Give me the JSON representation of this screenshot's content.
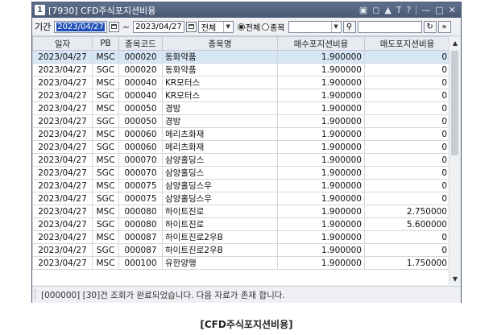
{
  "window": {
    "screen_no": "1",
    "title": "[7930] CFD주식포지션비용"
  },
  "toolbar": {
    "period_label": "기간",
    "date_from": "2023/04/27",
    "tilde": "~",
    "date_to": "2023/04/27",
    "market_select": "전체",
    "radio_all": "전체",
    "radio_item": "종목",
    "item_code": ""
  },
  "table": {
    "headers": [
      "일자",
      "PB",
      "종목코드",
      "종목명",
      "매수포지션비용",
      "매도포지션비용"
    ],
    "rows": [
      [
        "2023/04/27",
        "MSC",
        "000020",
        "동화약품",
        "1.900000",
        "0"
      ],
      [
        "2023/04/27",
        "SGC",
        "000020",
        "동화약품",
        "1.900000",
        "0"
      ],
      [
        "2023/04/27",
        "MSC",
        "000040",
        "KR모터스",
        "1.900000",
        "0"
      ],
      [
        "2023/04/27",
        "SGC",
        "000040",
        "KR모터스",
        "1.900000",
        "0"
      ],
      [
        "2023/04/27",
        "MSC",
        "000050",
        "경방",
        "1.900000",
        "0"
      ],
      [
        "2023/04/27",
        "SGC",
        "000050",
        "경방",
        "1.900000",
        "0"
      ],
      [
        "2023/04/27",
        "MSC",
        "000060",
        "메리츠화재",
        "1.900000",
        "0"
      ],
      [
        "2023/04/27",
        "SGC",
        "000060",
        "메리츠화재",
        "1.900000",
        "0"
      ],
      [
        "2023/04/27",
        "MSC",
        "000070",
        "삼양홀딩스",
        "1.900000",
        "0"
      ],
      [
        "2023/04/27",
        "SGC",
        "000070",
        "삼양홀딩스",
        "1.900000",
        "0"
      ],
      [
        "2023/04/27",
        "MSC",
        "000075",
        "삼양홀딩스우",
        "1.900000",
        "0"
      ],
      [
        "2023/04/27",
        "SGC",
        "000075",
        "삼양홀딩스우",
        "1.900000",
        "0"
      ],
      [
        "2023/04/27",
        "MSC",
        "000080",
        "하이트진로",
        "1.900000",
        "2.750000"
      ],
      [
        "2023/04/27",
        "SGC",
        "000080",
        "하이트진로",
        "1.900000",
        "5.600000"
      ],
      [
        "2023/04/27",
        "MSC",
        "000087",
        "하이트진로2우B",
        "1.900000",
        "0"
      ],
      [
        "2023/04/27",
        "SGC",
        "000087",
        "하이트진로2우B",
        "1.900000",
        "0"
      ],
      [
        "2023/04/27",
        "MSC",
        "000100",
        "유한양행",
        "1.900000",
        "1.750000"
      ]
    ]
  },
  "status": {
    "message": "[000000] [30]건 조회가 완료되었습니다. 다음 자료가 존재 합니다."
  },
  "caption": "[CFD주식포지션비용]"
}
